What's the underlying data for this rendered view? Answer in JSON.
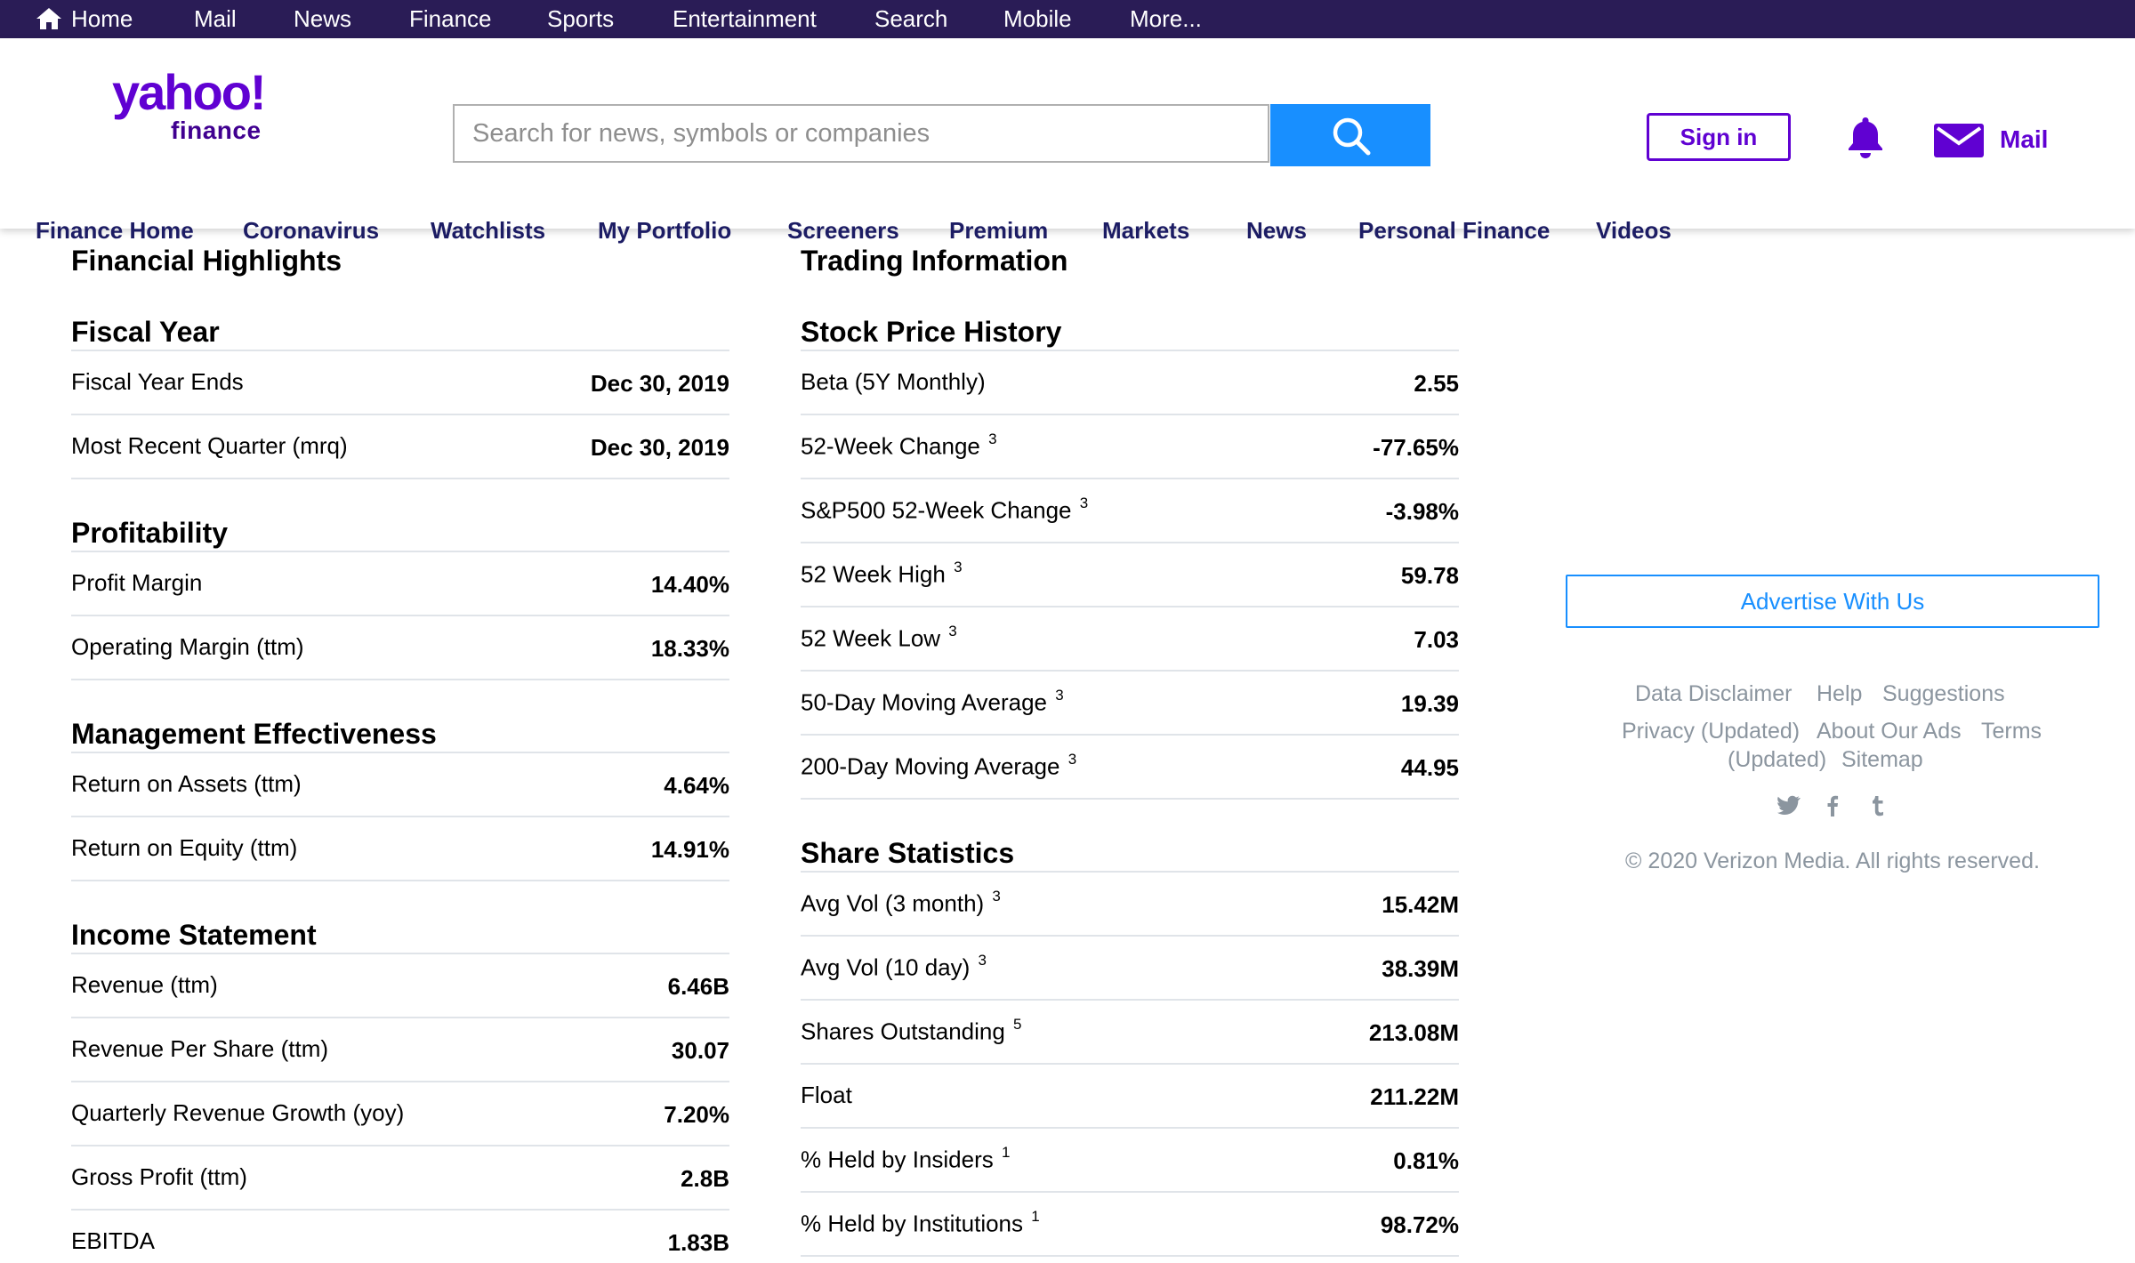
{
  "topbar": {
    "items": [
      "Home",
      "Mail",
      "News",
      "Finance",
      "Sports",
      "Entertainment",
      "Search",
      "Mobile",
      "More..."
    ]
  },
  "header": {
    "logo_main": "yahoo!",
    "logo_sub": "finance",
    "search_placeholder": "Search for news, symbols or companies",
    "signin_label": "Sign in",
    "mail_label": "Mail",
    "brand_color": "#6001d2",
    "search_button_color": "#188fff"
  },
  "nav": {
    "items": [
      "Finance Home",
      "Coronavirus",
      "Watchlists",
      "My Portfolio",
      "Screeners",
      "Premium",
      "Markets",
      "News",
      "Personal Finance",
      "Videos"
    ]
  },
  "left": {
    "title": "Financial Highlights",
    "fiscal_year": {
      "heading": "Fiscal Year",
      "rows": [
        {
          "label": "Fiscal Year Ends",
          "sup": "",
          "value": "Dec 30, 2019"
        },
        {
          "label": "Most Recent Quarter (mrq)",
          "sup": "",
          "value": "Dec 30, 2019"
        }
      ]
    },
    "profitability": {
      "heading": "Profitability",
      "rows": [
        {
          "label": "Profit Margin",
          "sup": "",
          "value": "14.40%"
        },
        {
          "label": "Operating Margin (ttm)",
          "sup": "",
          "value": "18.33%"
        }
      ]
    },
    "management": {
      "heading": "Management Effectiveness",
      "rows": [
        {
          "label": "Return on Assets (ttm)",
          "sup": "",
          "value": "4.64%"
        },
        {
          "label": "Return on Equity (ttm)",
          "sup": "",
          "value": "14.91%"
        }
      ]
    },
    "income": {
      "heading": "Income Statement",
      "rows": [
        {
          "label": "Revenue (ttm)",
          "sup": "",
          "value": "6.46B"
        },
        {
          "label": "Revenue Per Share (ttm)",
          "sup": "",
          "value": "30.07"
        },
        {
          "label": "Quarterly Revenue Growth (yoy)",
          "sup": "",
          "value": "7.20%"
        },
        {
          "label": "Gross Profit (ttm)",
          "sup": "",
          "value": "2.8B"
        },
        {
          "label": "EBITDA",
          "sup": "",
          "value": "1.83B"
        }
      ]
    }
  },
  "middle": {
    "title": "Trading Information",
    "price_history": {
      "heading": "Stock Price History",
      "rows": [
        {
          "label": "Beta (5Y Monthly)",
          "sup": "",
          "value": "2.55"
        },
        {
          "label": "52-Week Change",
          "sup": "3",
          "value": "-77.65%"
        },
        {
          "label": "S&P500 52-Week Change",
          "sup": "3",
          "value": "-3.98%"
        },
        {
          "label": "52 Week High",
          "sup": "3",
          "value": "59.78"
        },
        {
          "label": "52 Week Low",
          "sup": "3",
          "value": "7.03"
        },
        {
          "label": "50-Day Moving Average",
          "sup": "3",
          "value": "19.39"
        },
        {
          "label": "200-Day Moving Average",
          "sup": "3",
          "value": "44.95"
        }
      ]
    },
    "share_stats": {
      "heading": "Share Statistics",
      "rows": [
        {
          "label": "Avg Vol (3 month)",
          "sup": "3",
          "value": "15.42M"
        },
        {
          "label": "Avg Vol (10 day)",
          "sup": "3",
          "value": "38.39M"
        },
        {
          "label": "Shares Outstanding",
          "sup": "5",
          "value": "213.08M"
        },
        {
          "label": "Float",
          "sup": "",
          "value": "211.22M"
        },
        {
          "label": "% Held by Insiders",
          "sup": "1",
          "value": "0.81%"
        },
        {
          "label": "% Held by Institutions",
          "sup": "1",
          "value": "98.72%"
        }
      ]
    }
  },
  "right": {
    "advertise_label": "Advertise With Us",
    "footer_links": {
      "data_disclaimer": "Data Disclaimer",
      "help": "Help",
      "suggestions": "Suggestions",
      "privacy": "Privacy (Updated)",
      "about_ads": "About Our Ads",
      "terms": "Terms",
      "terms_updated": "(Updated)",
      "sitemap": "Sitemap"
    },
    "social_icons": [
      "twitter-icon",
      "facebook-icon",
      "tumblr-icon"
    ],
    "copyright": "© 2020 Verizon Media. All rights reserved."
  }
}
